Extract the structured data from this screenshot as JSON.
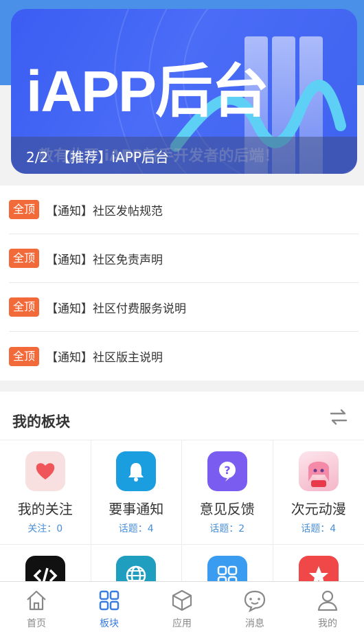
{
  "banner": {
    "title": "iAPP后台",
    "subtitle": "教有此开 iAPP新手开发者的后端！",
    "counter": "2/2",
    "caption": "【推荐】iAPP后台"
  },
  "notices": [
    {
      "badge": "全顶",
      "text": "【通知】社区发帖规范"
    },
    {
      "badge": "全顶",
      "text": "【通知】社区免责声明"
    },
    {
      "badge": "全顶",
      "text": "【通知】社区付费服务说明"
    },
    {
      "badge": "全顶",
      "text": "【通知】社区版主说明"
    }
  ],
  "boards": {
    "title": "我的板块",
    "items": [
      {
        "name": "我的关注",
        "meta": "关注：0",
        "icon": "heart-icon",
        "color": "#f8e0e0"
      },
      {
        "name": "要事通知",
        "meta": "话题：4",
        "icon": "bell-icon",
        "color": "#1a9ee0"
      },
      {
        "name": "意见反馈",
        "meta": "话题：2",
        "icon": "question-icon",
        "color": "#7a5cf0"
      },
      {
        "name": "次元动漫",
        "meta": "话题：4",
        "icon": "anime-avatar-icon",
        "color": "#f7c9d6"
      },
      {
        "name": "",
        "meta": "",
        "icon": "code-icon",
        "color": "#111111"
      },
      {
        "name": "",
        "meta": "",
        "icon": "globe-icon",
        "color": "#1f9ec0"
      },
      {
        "name": "",
        "meta": "",
        "icon": "grid-apps-icon",
        "color": "#3a9cf0"
      },
      {
        "name": "",
        "meta": "",
        "icon": "star-icon",
        "color": "#f04848"
      }
    ]
  },
  "tabbar": [
    {
      "label": "首页",
      "icon": "home-icon"
    },
    {
      "label": "板块",
      "icon": "board-icon",
      "active": true
    },
    {
      "label": "应用",
      "icon": "box-icon"
    },
    {
      "label": "消息",
      "icon": "chat-icon"
    },
    {
      "label": "我的",
      "icon": "user-icon"
    }
  ]
}
